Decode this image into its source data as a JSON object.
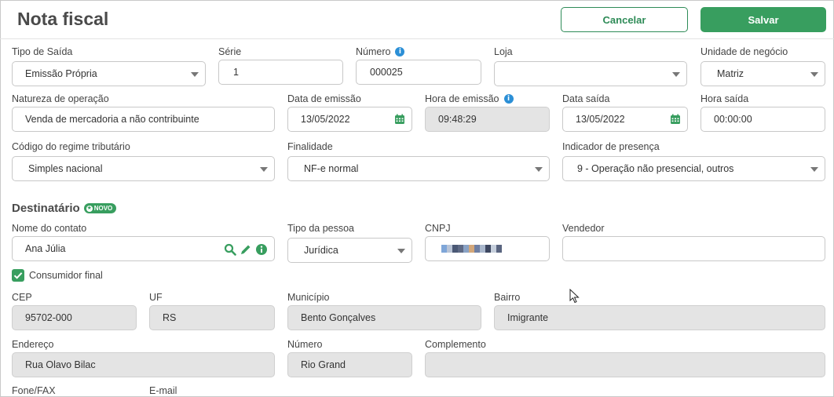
{
  "header": {
    "title": "Nota fiscal",
    "cancel_label": "Cancelar",
    "save_label": "Salvar"
  },
  "row1": {
    "tipo_saida": {
      "label": "Tipo de Saída",
      "value": "Emissão Própria"
    },
    "serie": {
      "label": "Série",
      "value": "1"
    },
    "numero": {
      "label": "Número",
      "value": "000025"
    },
    "loja": {
      "label": "Loja",
      "value": ""
    },
    "unidade_negocio": {
      "label": "Unidade de negócio",
      "value": "Matriz"
    }
  },
  "row2": {
    "natureza": {
      "label": "Natureza de operação",
      "value": "Venda de mercadoria a não contribuinte"
    },
    "data_emissao": {
      "label": "Data de emissão",
      "value": "13/05/2022"
    },
    "hora_emissao": {
      "label": "Hora de emissão",
      "value": "09:48:29"
    },
    "data_saida": {
      "label": "Data saída",
      "value": "13/05/2022"
    },
    "hora_saida": {
      "label": "Hora saída",
      "value": "00:00:00"
    }
  },
  "row3": {
    "regime": {
      "label": "Código do regime tributário",
      "value": "Simples nacional"
    },
    "finalidade": {
      "label": "Finalidade",
      "value": "NF-e normal"
    },
    "presenca": {
      "label": "Indicador de presença",
      "value": "9 - Operação não presencial, outros"
    }
  },
  "destinatario": {
    "title": "Destinatário",
    "badge": "NOVO",
    "nome": {
      "label": "Nome do contato",
      "value": "Ana Júlia"
    },
    "tipo_pessoa": {
      "label": "Tipo da pessoa",
      "value": "Jurídica"
    },
    "cnpj": {
      "label": "CNPJ"
    },
    "vendedor": {
      "label": "Vendedor",
      "value": ""
    },
    "consumidor_final": {
      "label": "Consumidor final",
      "checked": true
    },
    "cep": {
      "label": "CEP",
      "value": "95702-000"
    },
    "uf": {
      "label": "UF",
      "value": "RS"
    },
    "municipio": {
      "label": "Município",
      "value": "Bento Gonçalves"
    },
    "bairro": {
      "label": "Bairro",
      "value": "Imigrante"
    },
    "endereco": {
      "label": "Endereço",
      "value": "Rua Olavo Bilac"
    },
    "numero": {
      "label": "Número",
      "value": "Rio Grand"
    },
    "complemento": {
      "label": "Complemento",
      "value": ""
    },
    "fone": {
      "label": "Fone/FAX"
    },
    "email": {
      "label": "E-mail"
    }
  },
  "colors": {
    "accent": "#389e5f",
    "info": "#2b8fd6",
    "readonly_bg": "#e4e4e4"
  },
  "icons": [
    "info-icon",
    "calendar-icon",
    "caret-down-icon",
    "search-icon",
    "edit-pencil-icon",
    "star-icon",
    "check-icon",
    "mouse-cursor-icon"
  ]
}
